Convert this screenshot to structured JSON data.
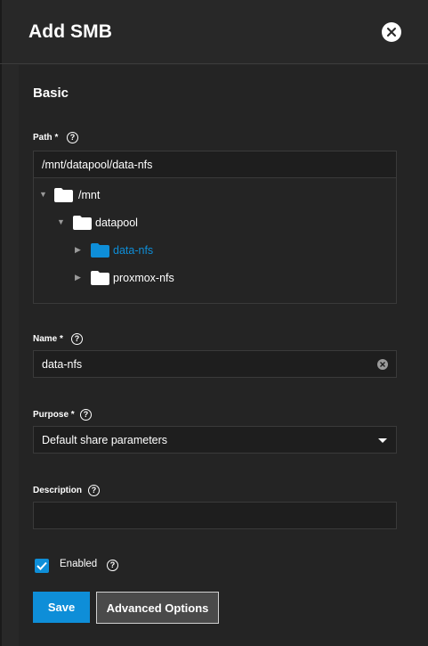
{
  "header": {
    "title": "Add SMB"
  },
  "section": {
    "title": "Basic"
  },
  "path": {
    "label": "Path *",
    "value": "/mnt/datapool/data-nfs",
    "tree": [
      {
        "label": "/mnt",
        "expanded": true,
        "active": false
      },
      {
        "label": "datapool",
        "expanded": true,
        "active": false
      },
      {
        "label": "data-nfs",
        "expanded": false,
        "active": true
      },
      {
        "label": "proxmox-nfs",
        "expanded": false,
        "active": false
      }
    ]
  },
  "name": {
    "label": "Name *",
    "value": "data-nfs"
  },
  "purpose": {
    "label": "Purpose *",
    "value": "Default share parameters"
  },
  "description": {
    "label": "Description",
    "value": ""
  },
  "enabled": {
    "label": "Enabled",
    "checked": true
  },
  "actions": {
    "save": "Save",
    "advanced": "Advanced Options"
  },
  "icons": {
    "help": "?",
    "close": "close-icon",
    "folder": "folder-icon"
  },
  "colors": {
    "accent": "#0e8ed8",
    "background": "#282828",
    "input_bg": "#1e1e1e"
  }
}
